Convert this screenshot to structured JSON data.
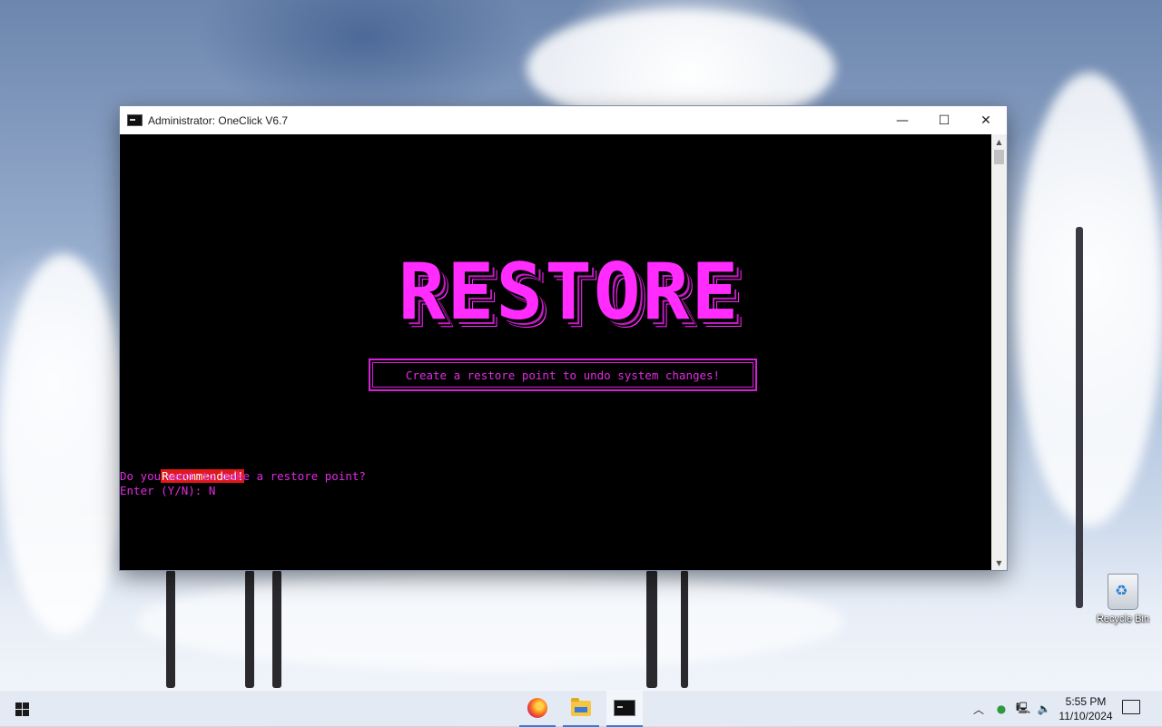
{
  "window": {
    "title": "Administrator:  OneClick V6.7",
    "buttons": {
      "minimize": "—",
      "maximize": "☐",
      "close": "✕"
    }
  },
  "console": {
    "banner": "RESTORE",
    "subtitle": "Create a restore point to undo system changes!",
    "lines": {
      "recommended": "Recommended!",
      "question": "Do you want to make a restore point?",
      "prompt": "Enter (Y/N): N"
    }
  },
  "desktop": {
    "recycle_bin_label": "Recycle Bin"
  },
  "taskbar": {
    "apps": [
      {
        "name": "firefox",
        "icon": "firefox-icon"
      },
      {
        "name": "file-explorer",
        "icon": "folder-icon"
      },
      {
        "name": "command-prompt",
        "icon": "cmd-icon"
      }
    ],
    "tray_icons": [
      "chevron-up-icon",
      "people-icon",
      "network-icon",
      "volume-icon"
    ],
    "time": "5:55 PM",
    "date": "11/10/2024"
  },
  "colors": {
    "console_bg": "#000000",
    "magenta": "#e02be0",
    "recommended_bg": "#e01818"
  }
}
